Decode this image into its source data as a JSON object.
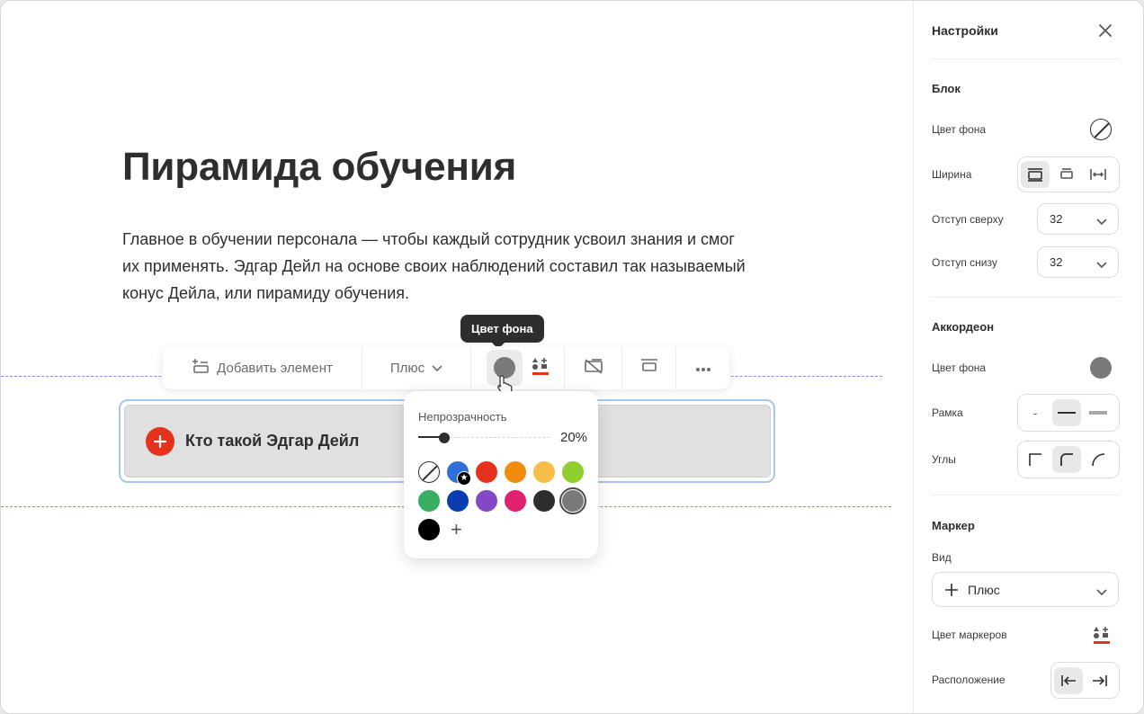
{
  "canvas": {
    "title": "Пирамида обучения",
    "paragraph": "Главное в обучении персонала — чтобы каждый сотрудник усвоил знания и смог их применять. Эдгар Дейл на основе своих наблюдений составил так называемый конус Дейла, или пирамиду обучения.",
    "accordion_title": "Кто такой Эдгар Дейл"
  },
  "toolbar": {
    "add_element_label": "Добавить элемент",
    "marker_type_label": "Плюс",
    "tooltip": "Цвет фона",
    "current_bg_color": "#7a7a7c"
  },
  "color_popover": {
    "opacity_label": "Непрозрачность",
    "opacity_value": "20%",
    "opacity_fraction": 0.2,
    "colors": [
      "none",
      "#2f6fdc",
      "#e5321c",
      "#f28c0f",
      "#f7bf4a",
      "#8ecf2e",
      "#38ae63",
      "#0a3db0",
      "#8447c6",
      "#e0216f",
      "#2e2e31",
      "#7a7a7c",
      "#000000"
    ],
    "selected_color": "#7a7a7c",
    "add_label": "+"
  },
  "sidebar": {
    "title": "Настройки",
    "block": {
      "section": "Блок",
      "bg_color_label": "Цвет фона",
      "width_label": "Ширина",
      "padding_top_label": "Отступ сверху",
      "padding_top_value": "32",
      "padding_bottom_label": "Отступ снизу",
      "padding_bottom_value": "32"
    },
    "accordion": {
      "section": "Аккордеон",
      "bg_color_label": "Цвет фона",
      "bg_color": "#7a7a7c",
      "border_label": "Рамка",
      "border_none": "-",
      "corners_label": "Углы"
    },
    "marker": {
      "section": "Маркер",
      "type_label": "Вид",
      "type_value": "Плюс",
      "color_label": "Цвет маркеров",
      "position_label": "Расположение"
    }
  },
  "colors": {
    "accent_red": "#e5321c",
    "selection_blue": "#a9c6ef",
    "guide_purple": "#8d87d6"
  }
}
